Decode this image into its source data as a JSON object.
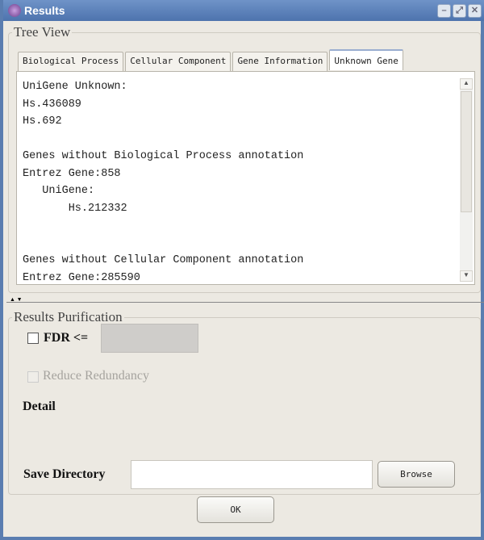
{
  "window": {
    "title": "Results",
    "icon": "app-icon",
    "controls": [
      "minimize",
      "maximize",
      "close"
    ]
  },
  "tree_view": {
    "legend": "Tree View",
    "tabs": [
      {
        "label": "Biological Process"
      },
      {
        "label": "Cellular Component"
      },
      {
        "label": "Gene Information"
      },
      {
        "label": "Unknown Gene",
        "active": true
      }
    ],
    "content": "UniGene Unknown:\nHs.436089\nHs.692\n\nGenes without Biological Process annotation\nEntrez Gene:858\n   UniGene:\n       Hs.212332\n\n\nGenes without Cellular Component annotation\nEntrez Gene:285590"
  },
  "purification": {
    "legend": "Results Purification",
    "fdr_label": "FDR <=",
    "fdr_checked": false,
    "fdr_value": "",
    "reduce_redundancy_label": "Reduce Redundancy",
    "reduce_redundancy_enabled": false,
    "detail_label": "Detail",
    "save_directory_label": "Save Directory",
    "save_directory_value": "",
    "browse_label": "Browse"
  },
  "ok_label": "OK"
}
